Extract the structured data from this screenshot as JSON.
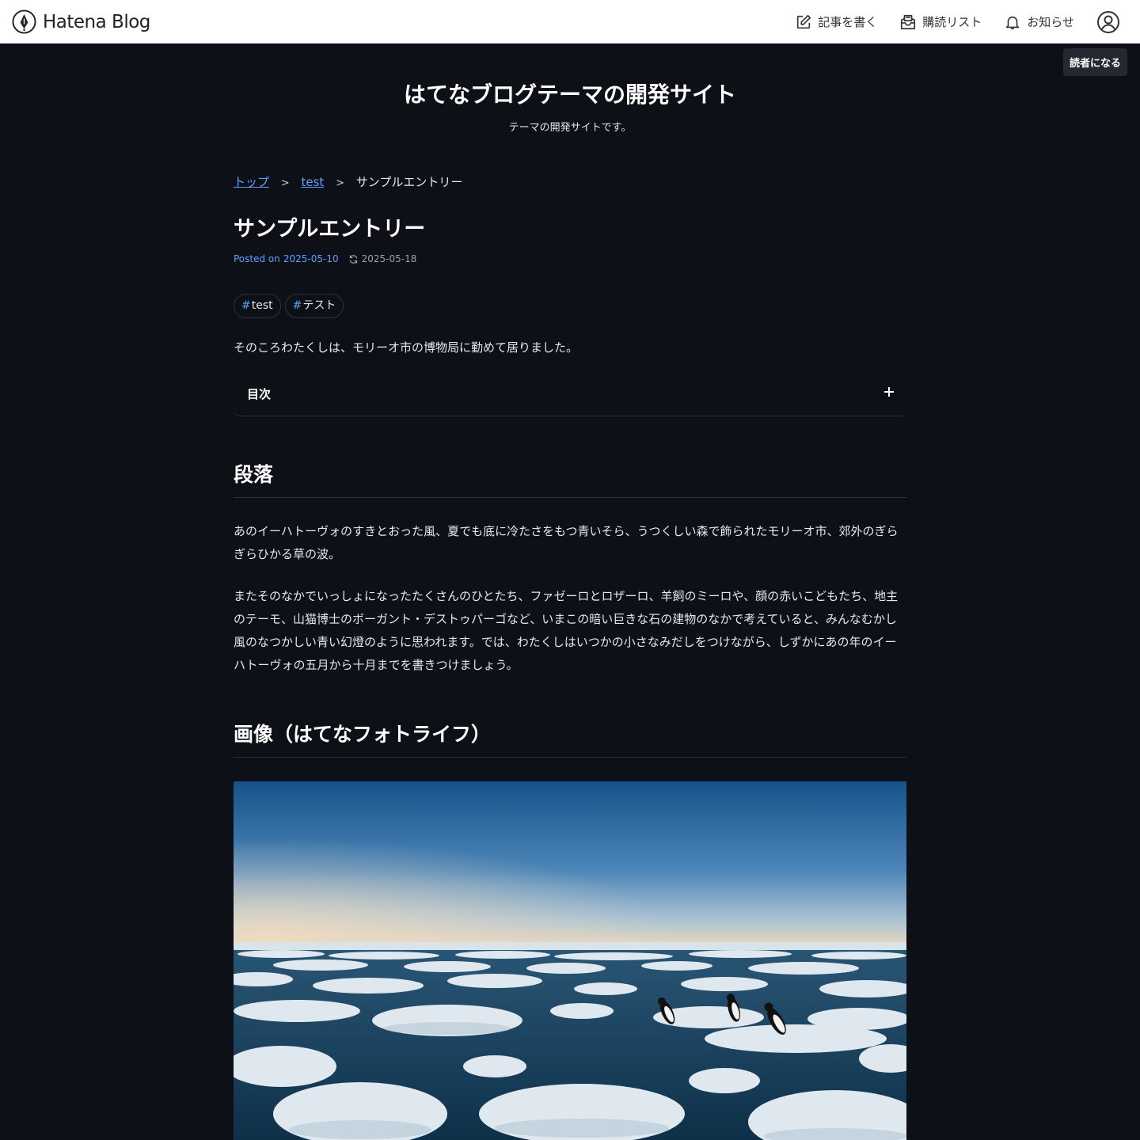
{
  "global_header": {
    "logo_text": "Hatena Blog",
    "menu": {
      "write": "記事を書く",
      "reading_list": "購読リスト",
      "notifications": "お知らせ"
    }
  },
  "subscribe_label": "読者になる",
  "blog": {
    "title": "はてなブログテーマの開発サイト",
    "description": "テーマの開発サイトです。"
  },
  "breadcrumb": {
    "top": "トップ",
    "category": "test",
    "separator": ">",
    "current": "サンプルエントリー"
  },
  "entry": {
    "title": "サンプルエントリー",
    "posted_label": "Posted on",
    "posted_date": "2025-05-10",
    "updated_date": "2025-05-18",
    "tags": [
      {
        "hash": "#",
        "label": "test"
      },
      {
        "hash": "#",
        "label": "テスト"
      }
    ],
    "lead": "そのころわたくしは、モリーオ市の博物局に勤めて居りました。",
    "toc_title": "目次",
    "section1": {
      "heading": "段落",
      "paragraphs": [
        "あのイーハトーヴォのすきとおった風、夏でも底に冷たさをもつ青いそら、うつくしい森で飾られたモリーオ市、郊外のぎらぎらひかる草の波。",
        "またそのなかでいっしょになったたくさんのひとたち、ファゼーロとロザーロ、羊飼のミーロや、顔の赤いこどもたち、地主のテーモ、山猫博士のボーガント・デストゥパーゴなど、いまこの暗い巨きな石の建物のなかで考えていると、みんなむかし風のなつかしい青い幻燈のように思われます。では、わたくしはいつかの小さなみだしをつけながら、しずかにあの年のイーハトーヴォの五月から十月までを書きつけましょう。"
      ]
    },
    "section2": {
      "heading": "画像（はてなフォトライフ）"
    }
  },
  "colors": {
    "background": "#0e1018",
    "link": "#5aa0ff",
    "text": "#e6e8ee",
    "header_bg": "#ffffff"
  }
}
